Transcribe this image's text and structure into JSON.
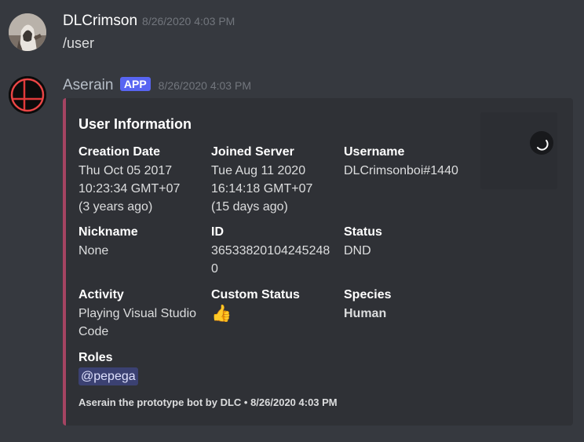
{
  "messages": [
    {
      "username": "DLCrimson",
      "username_color": "#ffffff",
      "timestamp": "8/26/2020 4:03 PM",
      "content": "/user",
      "avatar_icon": "hooded-figure-avatar"
    },
    {
      "username": "Aserain",
      "username_color": "#b6bec7",
      "bot_tag": "APP",
      "timestamp": "8/26/2020 4:03 PM",
      "avatar_icon": "smash-ball-avatar"
    }
  ],
  "embed": {
    "color": "#a54462",
    "title": "User Information",
    "fields": {
      "creation_date": {
        "name": "Creation Date",
        "lines": [
          "Thu Oct 05 2017",
          "10:23:34 GMT+07",
          "(3 years ago)"
        ]
      },
      "joined_server": {
        "name": "Joined Server",
        "lines": [
          "Tue Aug 11 2020",
          "16:14:18 GMT+07",
          "(15 days ago)"
        ]
      },
      "username": {
        "name": "Username",
        "lines": [
          "DLCrimsonboi#1440"
        ]
      },
      "nickname": {
        "name": "Nickname",
        "lines": [
          "None"
        ]
      },
      "id": {
        "name": "ID",
        "lines": [
          "36533820104245248",
          "0"
        ]
      },
      "status": {
        "name": "Status",
        "lines": [
          "DND"
        ]
      },
      "activity": {
        "name": "Activity",
        "lines": [
          "Playing Visual Studio",
          "Code"
        ]
      },
      "custom_status": {
        "name": "Custom Status",
        "emoji": "👍"
      },
      "species": {
        "name": "Species",
        "lines": [
          "Human"
        ]
      },
      "roles": {
        "name": "Roles",
        "mention": "@pepega"
      }
    },
    "footer": "Aserain the prototype bot by DLC • 8/26/2020 4:03 PM",
    "thumbnail_icon": "loading-spinner-icon"
  }
}
